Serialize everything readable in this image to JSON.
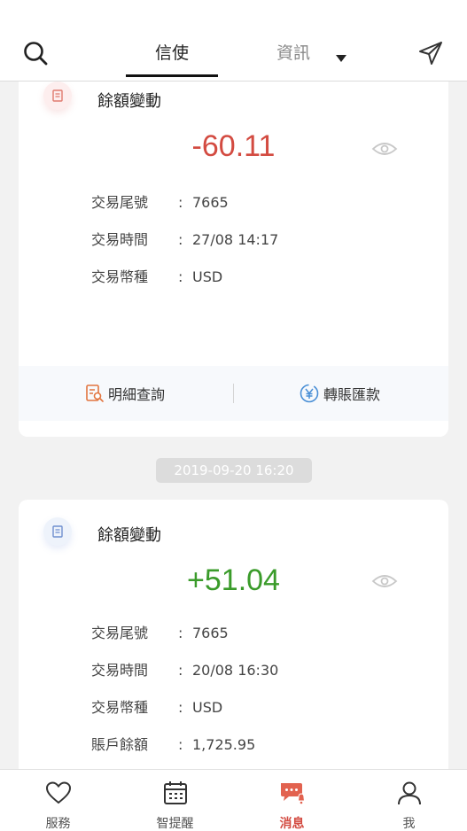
{
  "header": {
    "tab_active": "信使",
    "tab_inactive": "資訊"
  },
  "cards": [
    {
      "title": "餘額變動",
      "amount": "-60.11",
      "amount_color": "#d34b41",
      "rows": [
        {
          "label": "交易尾號",
          "value": "7665"
        },
        {
          "label": "交易時間",
          "value": "27/08 14:17"
        },
        {
          "label": "交易幣種",
          "value": "USD"
        }
      ],
      "footer": {
        "detail_label": "明細查詢",
        "transfer_label": "轉賬匯款"
      }
    },
    {
      "title": "餘額變動",
      "amount": "+51.04",
      "amount_color": "#3a9b2a",
      "rows": [
        {
          "label": "交易尾號",
          "value": "7665"
        },
        {
          "label": "交易時間",
          "value": "20/08 16:30"
        },
        {
          "label": "交易幣種",
          "value": "USD"
        },
        {
          "label": "賬戶餘額",
          "value": "1,725.95"
        }
      ]
    }
  ],
  "timestamp": "2019-09-20 16:20",
  "colon": ":",
  "bottom_nav": [
    {
      "label": "服務",
      "icon": "heart-icon"
    },
    {
      "label": "智提醒",
      "icon": "calendar-icon"
    },
    {
      "label": "消息",
      "icon": "message-icon",
      "active": true
    },
    {
      "label": "我",
      "icon": "person-icon"
    }
  ],
  "colors": {
    "accent": "#d34b41",
    "positive": "#3a9b2a"
  }
}
